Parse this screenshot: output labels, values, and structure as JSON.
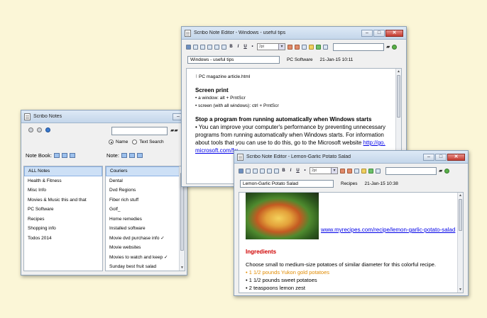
{
  "colors": {
    "background": "#fbf6d7",
    "link": "#0000e8",
    "heading_red": "#d00000",
    "highlight_orange": "#e08a00",
    "selection": "#cde0f6"
  },
  "main_window": {
    "title": "Scribo Notes",
    "search_icon": "binoculars-icon",
    "radio_name": "Name",
    "radio_text_search": "Text Search",
    "notebook_label": "Note Book:",
    "note_label": "Note:",
    "notebooks": [
      "ALL Notes",
      "Health & Fitness",
      "Misc Info",
      "Movies & Music this and that",
      "PC Software",
      "Recipes",
      "Shopping info",
      "Todos 2014"
    ],
    "notes": [
      "Couriers",
      "Dental",
      "Dvd Regions",
      "Fiber rich stuff",
      "Golf_",
      "Home remedies",
      "Installed software",
      "Movie dvd purchase info ✓",
      "Movie websites",
      "Movies to watch and keep ✓",
      "Sunday best fruit salad"
    ]
  },
  "editor1": {
    "title": "Scribo Note Editor - Windows - useful tips",
    "font_size": "2pt",
    "note_title": "Windows - useful tips",
    "notebook": "PC Software",
    "date": "21-Jan-15 10:11",
    "attachment": "PC magazine article.html",
    "h1": "Screen print",
    "b1": "• a window: alt + PrntScr",
    "b2": "• screen (with all windows): ctrl + PrntScr",
    "h2": "Stop a program from running automatically when Windows starts",
    "p1": "• You can improve your computer's performance by preventing unnecessary",
    "p2": "programs from running automatically when Windows starts. For information",
    "p3": "about tools that you can use to do this, go to the Microsoft website ",
    "link1": "http://go.",
    "link2": "microsoft.com/fw"
  },
  "editor2": {
    "title": "Scribo Note Editor - Lemon-Garlic Potato Salad",
    "font_size": "2pt",
    "note_title": "Lemon-Garlic Potato Salad",
    "notebook": "Recipes",
    "date": "21-Jan-15 10:38",
    "link": "www.myrecipes.com/recipe/lemon-garlic-potato-salad",
    "heading": "Ingredients",
    "intro": "Choose small to medium-size potatoes of similar diameter for this colorful recipe.",
    "ing1": "• 1 1/2 pounds Yukon gold potatoes",
    "ing2": "• 1 1/2 pounds sweet potatoes",
    "ing3": "• 2 teaspoons lemon zest"
  }
}
